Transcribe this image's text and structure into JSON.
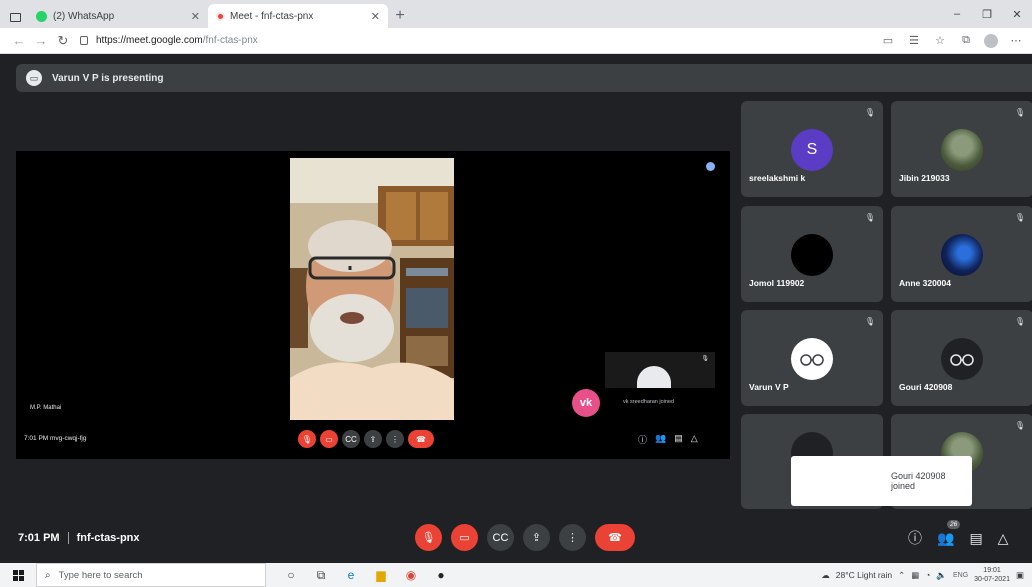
{
  "browser": {
    "tabs": [
      {
        "title": "(2) WhatsApp",
        "active": false
      },
      {
        "title": "Meet - fnf-ctas-pnx",
        "active": true
      }
    ],
    "new_tab": "+",
    "window_controls": [
      "–",
      "❐",
      "✕"
    ],
    "address": {
      "host": "https://meet.google.com",
      "path": "/fnf-ctas-pnx"
    }
  },
  "meet": {
    "presenting_banner": "Varun V P is presenting",
    "shared_screen": {
      "speaker_label": "M.P. Mathai",
      "mini_meeting_info": "7:01 PM    mvg-cwqj-fjg",
      "mini_toast_text": "vk sreedharan joined",
      "vk_initials": "vk"
    },
    "participants": [
      {
        "name": "sreelakshmi k",
        "avatar": "S",
        "avatar_style": "s"
      },
      {
        "name": "Jibin 219033",
        "avatar": "",
        "avatar_style": "photo1"
      },
      {
        "name": "Jomol 119902",
        "avatar": "",
        "avatar_style": "black"
      },
      {
        "name": "Anne 320004",
        "avatar": "",
        "avatar_style": "photo2"
      },
      {
        "name": "Varun V P",
        "avatar": "",
        "avatar_style": "white"
      },
      {
        "name": "Gouri 420908",
        "avatar": "",
        "avatar_style": "darkgray"
      },
      {
        "name": "",
        "avatar": "",
        "avatar_style": "darkgray"
      },
      {
        "name": "",
        "avatar": "",
        "avatar_style": "photo1"
      }
    ],
    "toast": "Gouri 420908 joined",
    "meeting_time": "7:01 PM",
    "meeting_code": "fnf-ctas-pnx",
    "participant_count": "26"
  },
  "taskbar": {
    "search_placeholder": "Type here to search",
    "weather": "28°C  Light rain",
    "language": "ENG",
    "time": "19:01",
    "date": "30-07-2021"
  },
  "colors": {
    "meet_bg": "#202124",
    "tile_bg": "#3c4043",
    "danger": "#ea4335",
    "vk_pink": "#e8508a"
  }
}
